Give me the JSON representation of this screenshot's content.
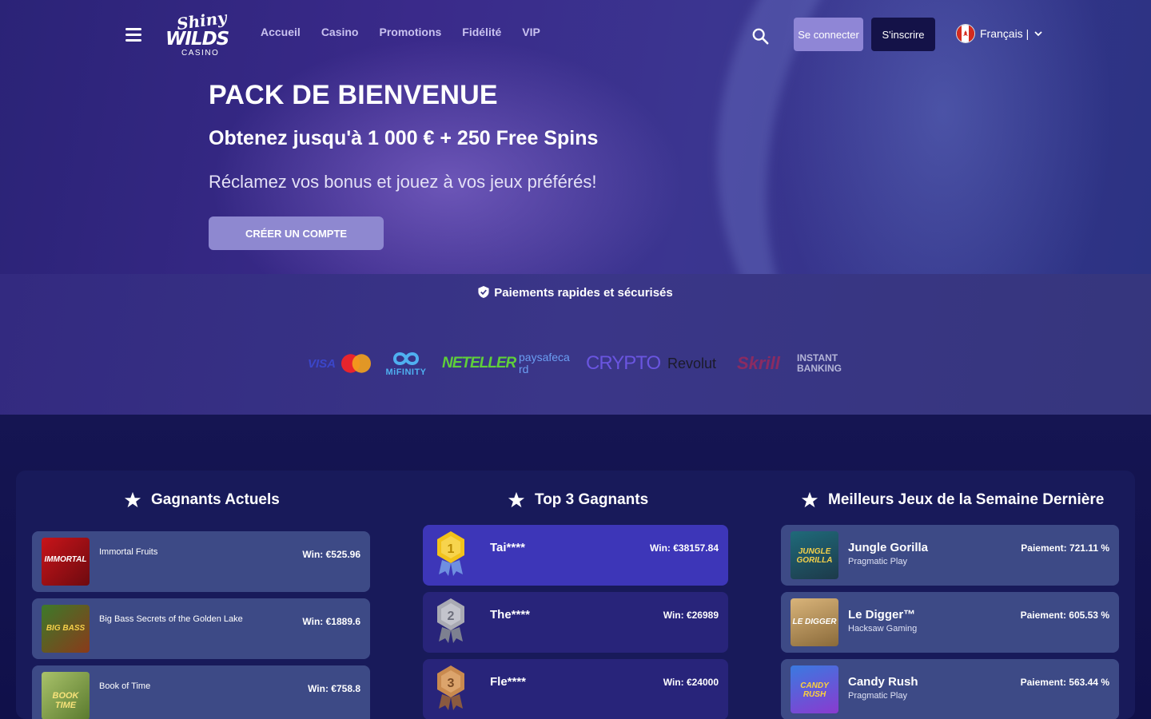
{
  "nav": {
    "logo": {
      "line1": "Shiny",
      "line2": "WILDS",
      "line3": "CASINO"
    },
    "menu": [
      "Accueil",
      "Casino",
      "Promotions",
      "Fidélité",
      "VIP"
    ],
    "login_label": "Se connecter",
    "signup_label": "S'inscrire",
    "language": "Français |",
    "icons": {
      "menu": "hamburger-icon",
      "search": "search-icon",
      "flag": "canada-flag-icon",
      "dropdown": "chevron-down-icon"
    }
  },
  "hero": {
    "title": "PACK DE BIENVENUE",
    "subtitle": "Obtenez jusqu'à 1 000 € + 250 Free Spins",
    "description": "Réclamez vos bonus et jouez à vos jeux préférés!",
    "cta_label": "CRÉER UN COMPTE"
  },
  "payments": {
    "heading": "Paiements rapides et sécurisés",
    "logos": [
      "VISA",
      "MiFINITY",
      "NETELLER",
      "paysafecard",
      "CRYPTO",
      "Revolut",
      "Skrill",
      "INSTANT BANKING"
    ]
  },
  "current_winners": {
    "title": "Gagnants Actuels",
    "items": [
      {
        "game": "Immortal Fruits",
        "win": "Win: €525.96",
        "thumb_text": "IMMORTAL"
      },
      {
        "game": "Big Bass Secrets of the Golden Lake",
        "win": "Win: €1889.6",
        "thumb_text": "BIG BASS"
      },
      {
        "game": "Book of Time",
        "win": "Win: €758.8",
        "thumb_text": "BOOK TIME"
      }
    ]
  },
  "top_winners": {
    "title": "Top 3 Gagnants",
    "items": [
      {
        "rank": "1",
        "name": "Tai****",
        "win": "Win: €38157.84"
      },
      {
        "rank": "2",
        "name": "The****",
        "win": "Win: €26989"
      },
      {
        "rank": "3",
        "name": "Fle****",
        "win": "Win: €24000"
      }
    ]
  },
  "best_games": {
    "title": "Meilleurs Jeux de la Semaine Dernière",
    "items": [
      {
        "game": "Jungle Gorilla",
        "provider": "Pragmatic Play",
        "payout": "Paiement: 721.11 %",
        "thumb_text": "JUNGLE GORILLA"
      },
      {
        "game": "Le Digger™",
        "provider": "Hacksaw Gaming",
        "payout": "Paiement: 605.53 %",
        "thumb_text": "LE DIGGER"
      },
      {
        "game": "Candy Rush",
        "provider": "Pragmatic Play",
        "payout": "Paiement: 563.44 %",
        "thumb_text": "CANDY RUSH"
      }
    ]
  },
  "colors": {
    "login_button": "#8f86d6",
    "signup_button": "#141248",
    "cta_button": "#8e88d0",
    "card_blue": "#3d4a86",
    "top_first": "#3d36b8",
    "gold": "#f2c21b",
    "silver": "#a9aab3",
    "bronze": "#c98a4f"
  }
}
